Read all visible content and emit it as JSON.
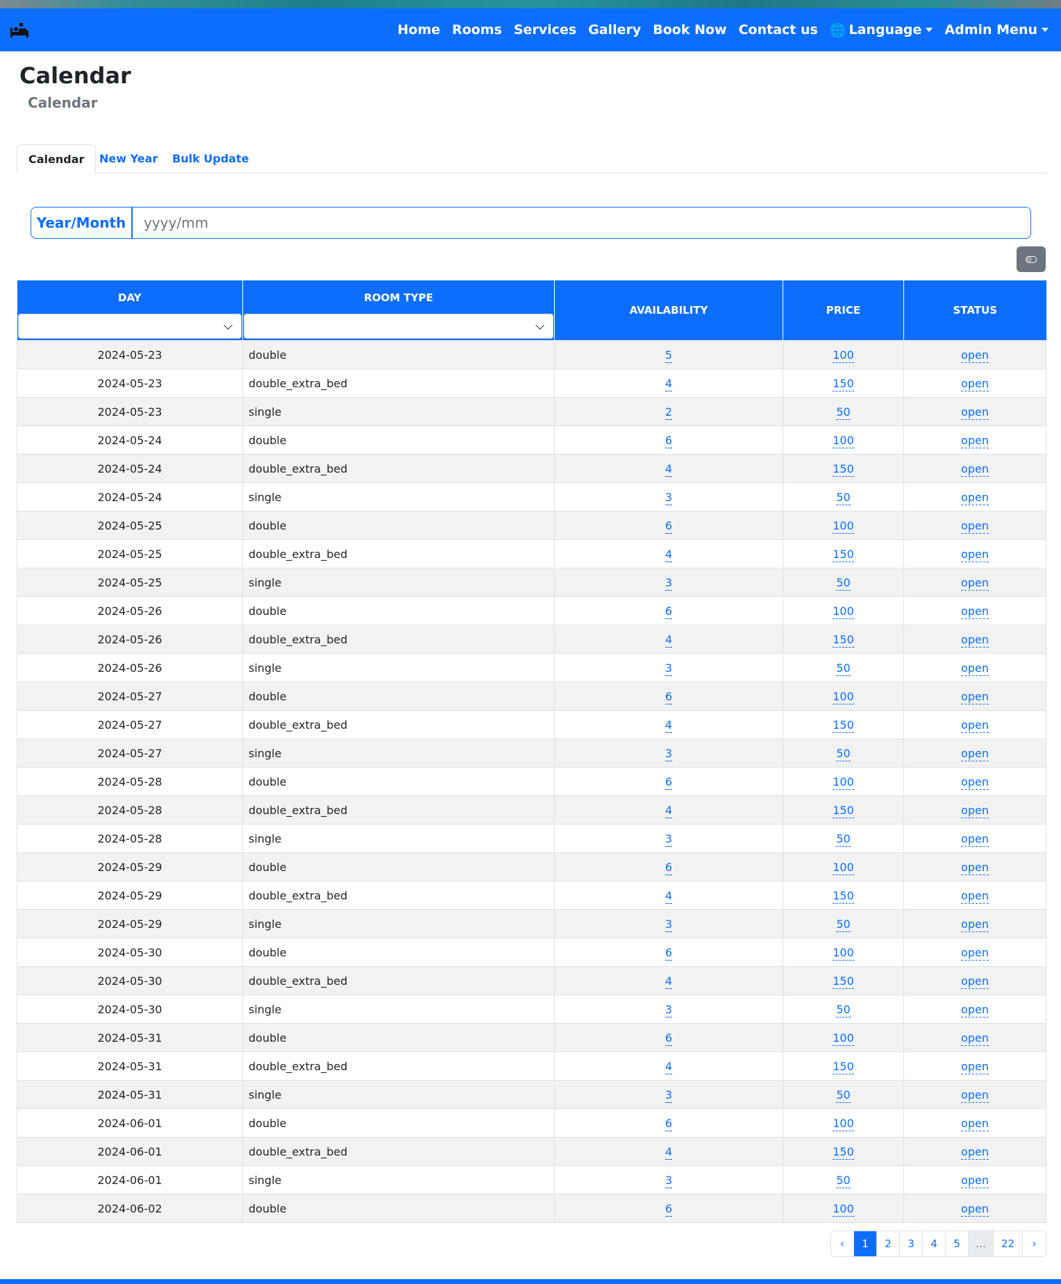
{
  "navbar": {
    "brand_icon": "hotel-bed-icon",
    "links": [
      "Home",
      "Rooms",
      "Services",
      "Gallery",
      "Book Now",
      "Contact us"
    ],
    "language": "Language",
    "admin_menu": "Admin Menu",
    "color": "#0d6efd"
  },
  "page": {
    "title": "Calendar",
    "subtitle": "Calendar"
  },
  "tabs": [
    {
      "label": "Calendar",
      "active": true
    },
    {
      "label": "New Year",
      "active": false
    },
    {
      "label": "Bulk Update",
      "active": false
    }
  ],
  "year_month": {
    "label": "Year/Month",
    "placeholder": "yyyy/mm",
    "value": ""
  },
  "table": {
    "headers": {
      "day": "DAY",
      "room_type": "ROOM TYPE",
      "availability": "AVAILABILITY",
      "price": "PRICE",
      "status": "STATUS"
    },
    "filters": {
      "day": "",
      "room_type": ""
    },
    "rows": [
      {
        "day": "2024-05-23",
        "type": "double",
        "availability": "5",
        "price": "100",
        "status": "open"
      },
      {
        "day": "2024-05-23",
        "type": "double_extra_bed",
        "availability": "4",
        "price": "150",
        "status": "open"
      },
      {
        "day": "2024-05-23",
        "type": "single",
        "availability": "2",
        "price": "50",
        "status": "open"
      },
      {
        "day": "2024-05-24",
        "type": "double",
        "availability": "6",
        "price": "100",
        "status": "open"
      },
      {
        "day": "2024-05-24",
        "type": "double_extra_bed",
        "availability": "4",
        "price": "150",
        "status": "open"
      },
      {
        "day": "2024-05-24",
        "type": "single",
        "availability": "3",
        "price": "50",
        "status": "open"
      },
      {
        "day": "2024-05-25",
        "type": "double",
        "availability": "6",
        "price": "100",
        "status": "open"
      },
      {
        "day": "2024-05-25",
        "type": "double_extra_bed",
        "availability": "4",
        "price": "150",
        "status": "open"
      },
      {
        "day": "2024-05-25",
        "type": "single",
        "availability": "3",
        "price": "50",
        "status": "open"
      },
      {
        "day": "2024-05-26",
        "type": "double",
        "availability": "6",
        "price": "100",
        "status": "open"
      },
      {
        "day": "2024-05-26",
        "type": "double_extra_bed",
        "availability": "4",
        "price": "150",
        "status": "open"
      },
      {
        "day": "2024-05-26",
        "type": "single",
        "availability": "3",
        "price": "50",
        "status": "open"
      },
      {
        "day": "2024-05-27",
        "type": "double",
        "availability": "6",
        "price": "100",
        "status": "open"
      },
      {
        "day": "2024-05-27",
        "type": "double_extra_bed",
        "availability": "4",
        "price": "150",
        "status": "open"
      },
      {
        "day": "2024-05-27",
        "type": "single",
        "availability": "3",
        "price": "50",
        "status": "open"
      },
      {
        "day": "2024-05-28",
        "type": "double",
        "availability": "6",
        "price": "100",
        "status": "open"
      },
      {
        "day": "2024-05-28",
        "type": "double_extra_bed",
        "availability": "4",
        "price": "150",
        "status": "open"
      },
      {
        "day": "2024-05-28",
        "type": "single",
        "availability": "3",
        "price": "50",
        "status": "open"
      },
      {
        "day": "2024-05-29",
        "type": "double",
        "availability": "6",
        "price": "100",
        "status": "open"
      },
      {
        "day": "2024-05-29",
        "type": "double_extra_bed",
        "availability": "4",
        "price": "150",
        "status": "open"
      },
      {
        "day": "2024-05-29",
        "type": "single",
        "availability": "3",
        "price": "50",
        "status": "open"
      },
      {
        "day": "2024-05-30",
        "type": "double",
        "availability": "6",
        "price": "100",
        "status": "open"
      },
      {
        "day": "2024-05-30",
        "type": "double_extra_bed",
        "availability": "4",
        "price": "150",
        "status": "open"
      },
      {
        "day": "2024-05-30",
        "type": "single",
        "availability": "3",
        "price": "50",
        "status": "open"
      },
      {
        "day": "2024-05-31",
        "type": "double",
        "availability": "6",
        "price": "100",
        "status": "open"
      },
      {
        "day": "2024-05-31",
        "type": "double_extra_bed",
        "availability": "4",
        "price": "150",
        "status": "open"
      },
      {
        "day": "2024-05-31",
        "type": "single",
        "availability": "3",
        "price": "50",
        "status": "open"
      },
      {
        "day": "2024-06-01",
        "type": "double",
        "availability": "6",
        "price": "100",
        "status": "open"
      },
      {
        "day": "2024-06-01",
        "type": "double_extra_bed",
        "availability": "4",
        "price": "150",
        "status": "open"
      },
      {
        "day": "2024-06-01",
        "type": "single",
        "availability": "3",
        "price": "50",
        "status": "open"
      },
      {
        "day": "2024-06-02",
        "type": "double",
        "availability": "6",
        "price": "100",
        "status": "open"
      }
    ]
  },
  "pagination": {
    "prev": "‹",
    "pages": [
      "1",
      "2",
      "3",
      "4",
      "5",
      "…",
      "22"
    ],
    "current": "1",
    "next": "›"
  }
}
